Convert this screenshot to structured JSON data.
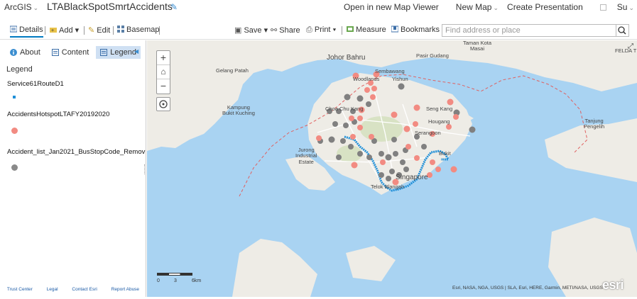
{
  "app": {
    "brand": "ArcGIS",
    "map_title": "LTABlackSpotSmrtAccidents"
  },
  "top_links": {
    "open_viewer": "Open in new Map Viewer",
    "new_map": "New Map",
    "create_presentation": "Create Presentation",
    "user": "Su"
  },
  "toolbar": {
    "details": "Details",
    "add": "Add",
    "edit": "Edit",
    "basemap": "Basemap",
    "save": "Save",
    "share": "Share",
    "print": "Print",
    "measure": "Measure",
    "bookmarks": "Bookmarks"
  },
  "search": {
    "placeholder": "Find address or place"
  },
  "sidebar": {
    "tabs": {
      "about": "About",
      "content": "Content",
      "legend": "Legend"
    },
    "legend_title": "Legend",
    "layers": [
      {
        "name": "Service61RouteD1",
        "color": "#1f8fd8"
      },
      {
        "name": "AccidentsHotspotLTAFY20192020",
        "color": "#f28b82"
      },
      {
        "name": "Accident_list_Jan2021_BusStopCode_Remov",
        "color": "#8a8a8a"
      }
    ],
    "footer": [
      "Trust Center",
      "Legal",
      "Contact Esri",
      "Report Abuse"
    ]
  },
  "map": {
    "scale_labels": [
      "0",
      "3",
      "6km"
    ],
    "attribution": "Esri, NASA, NGA, USGS | SLA, Esri, HERE, Garmin, METI/NASA, USGS",
    "esri_logo": "esri",
    "place_labels": {
      "johor_bahru": "Johor Bahru",
      "pasir_gudang": "Pasir Gudang",
      "taman_kota": "Taman Kota\nMasai",
      "gelang_patah": "Gelang Patah",
      "sembawang": "Sembawang",
      "woodlands": "Woodlands",
      "yishun": "Yishun",
      "kampung": "Kampung\nBukit Kuching",
      "choa_chu_kang": "Choa Chu Kang",
      "seng_kang": "Seng Kang",
      "hougang": "Hougang",
      "serangoon": "Serangoon",
      "tanjung": "Tanjung\nPengelih",
      "jurong": "Jurong\nIndustrial\nEstate",
      "singapore": "Singapore",
      "telok_blangah": "Telok Blangah",
      "bukit": "Bukit",
      "felda": "FELDA T"
    },
    "colors": {
      "water": "#a9d3f2",
      "land": "#eeece6",
      "hotspot": "#f28b82",
      "accident": "#808080",
      "route": "#1f8fd8"
    }
  }
}
